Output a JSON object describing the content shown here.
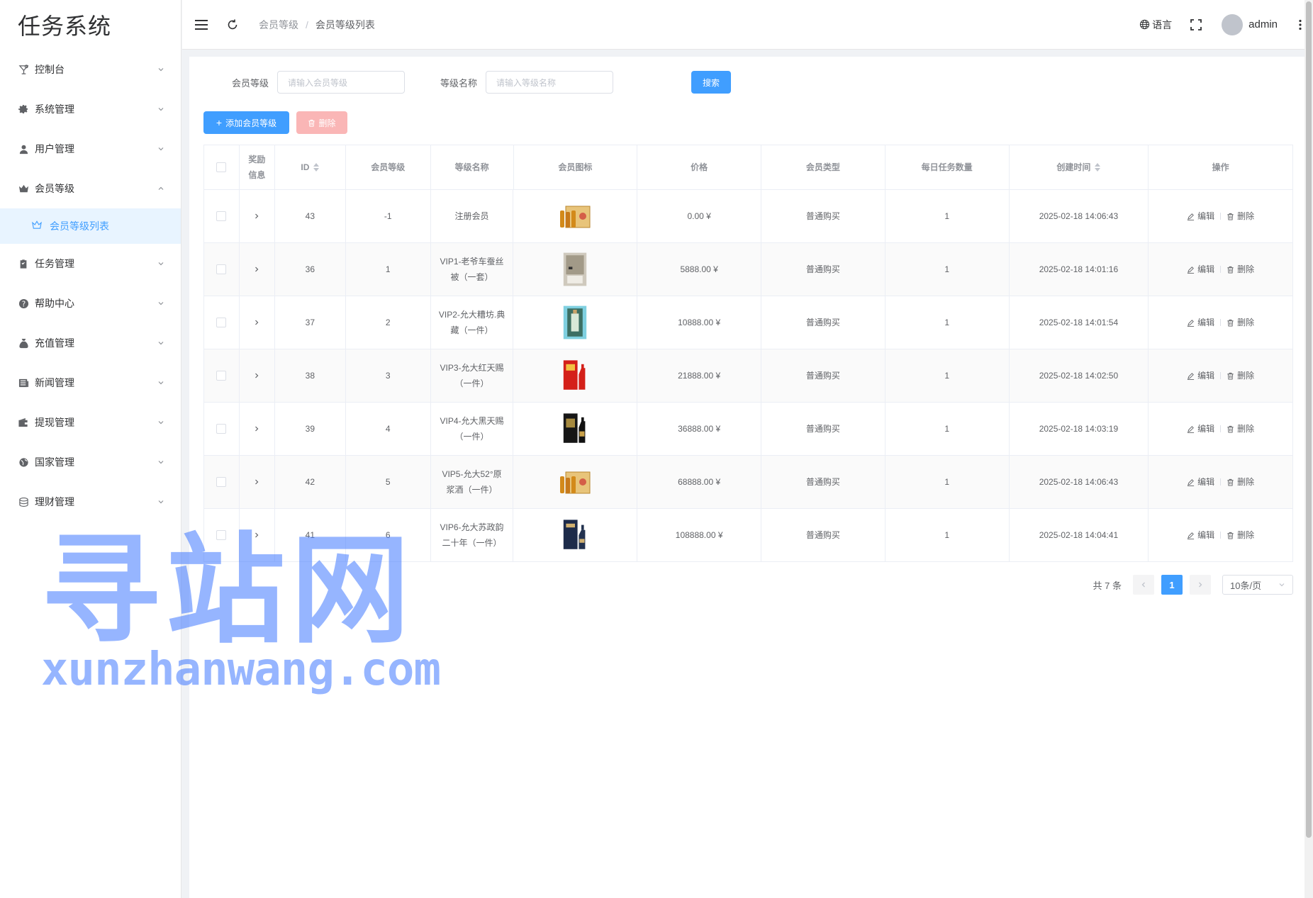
{
  "app": {
    "title": "任务系统"
  },
  "sidebar": {
    "items": [
      {
        "label": "控制台",
        "icon": "cocktail-icon"
      },
      {
        "label": "系统管理",
        "icon": "gear-icon"
      },
      {
        "label": "用户管理",
        "icon": "user-icon"
      },
      {
        "label": "会员等级",
        "icon": "crown-icon",
        "expanded": true,
        "children": [
          {
            "label": "会员等级列表",
            "icon": "crown-outline-icon"
          }
        ]
      },
      {
        "label": "任务管理",
        "icon": "clipboard-icon"
      },
      {
        "label": "帮助中心",
        "icon": "question-icon"
      },
      {
        "label": "充值管理",
        "icon": "money-bag-icon"
      },
      {
        "label": "新闻管理",
        "icon": "newspaper-icon"
      },
      {
        "label": "提现管理",
        "icon": "wallet-icon"
      },
      {
        "label": "国家管理",
        "icon": "globe-icon"
      },
      {
        "label": "理财管理",
        "icon": "coins-icon"
      }
    ]
  },
  "header": {
    "breadcrumb": [
      "会员等级",
      "会员等级列表"
    ],
    "language": "语言",
    "username": "admin"
  },
  "search": {
    "level_label": "会员等级",
    "level_placeholder": "请输入会员等级",
    "name_label": "等级名称",
    "name_placeholder": "请输入等级名称",
    "button": "搜索"
  },
  "toolbar": {
    "add_label": "添加会员等级",
    "delete_label": "删除"
  },
  "table": {
    "headers": [
      "奖励信息",
      "ID",
      "会员等级",
      "等级名称",
      "会员图标",
      "价格",
      "会员类型",
      "每日任务数量",
      "创建时间",
      "操作"
    ],
    "edit_label": "编辑",
    "delete_label": "删除",
    "rows": [
      {
        "id": "43",
        "level": "-1",
        "name": "注册会员",
        "price": "0.00 ¥",
        "type": "普通购买",
        "daily": "1",
        "created": "2025-02-18 14:06:43",
        "thumb": "gift-box-gold"
      },
      {
        "id": "36",
        "level": "1",
        "name": "VIP1-老爷车蚕丝被（一套）",
        "price": "5888.00 ¥",
        "type": "普通购买",
        "daily": "1",
        "created": "2025-02-18 14:01:16",
        "thumb": "silk-quilt"
      },
      {
        "id": "37",
        "level": "2",
        "name": "VIP2-允大糟坊.典藏（一件）",
        "price": "10888.00 ¥",
        "type": "普通购买",
        "daily": "1",
        "created": "2025-02-18 14:01:54",
        "thumb": "liquor-box-teal"
      },
      {
        "id": "38",
        "level": "3",
        "name": "VIP3-允大红天赐（一件）",
        "price": "21888.00 ¥",
        "type": "普通购买",
        "daily": "1",
        "created": "2025-02-18 14:02:50",
        "thumb": "liquor-box-red"
      },
      {
        "id": "39",
        "level": "4",
        "name": "VIP4-允大黑天赐（一件）",
        "price": "36888.00 ¥",
        "type": "普通购买",
        "daily": "1",
        "created": "2025-02-18 14:03:19",
        "thumb": "liquor-box-black"
      },
      {
        "id": "42",
        "level": "5",
        "name": "VIP5-允大52°原浆酒（一件）",
        "price": "68888.00 ¥",
        "type": "普通购买",
        "daily": "1",
        "created": "2025-02-18 14:06:43",
        "thumb": "gift-box-gold"
      },
      {
        "id": "41",
        "level": "6",
        "name": "VIP6-允大苏政韵二十年（一件）",
        "price": "108888.00 ¥",
        "type": "普通购买",
        "daily": "1",
        "created": "2025-02-18 14:04:41",
        "thumb": "liquor-box-navy"
      }
    ]
  },
  "pagination": {
    "total": "共 7 条",
    "current": "1",
    "page_size": "10条/页"
  },
  "watermark": {
    "cn": "寻站网",
    "en": "xunzhanwang.com"
  },
  "colors": {
    "primary": "#409eff",
    "danger_disabled": "#fab6b6",
    "active_bg": "#e8f4ff"
  }
}
